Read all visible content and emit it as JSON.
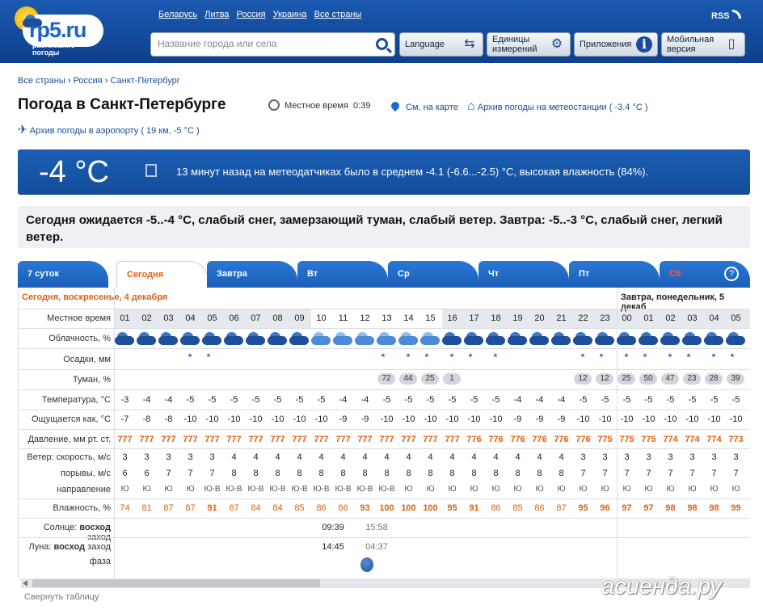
{
  "header": {
    "brand": "rp5.ru",
    "brand_sub_1": "расписание",
    "brand_sub_2": "погоды",
    "links": [
      "Беларусь",
      "Литва",
      "Россия",
      "Украина",
      "Все страны"
    ],
    "rss": "RSS",
    "search_placeholder": "Название города или села",
    "buttons": {
      "language": "Language",
      "units_1": "Единицы",
      "units_2": "измерений",
      "apps": "Приложения",
      "mobile_1": "Мобильная",
      "mobile_2": "версия"
    }
  },
  "breadcrumbs": [
    "Все страны",
    "Россия",
    "Санкт-Петербург"
  ],
  "breadcrumb_sep": "›",
  "title": "Погода в Санкт-Петербурге",
  "local_time_label": "Местное время",
  "local_time": "0:39",
  "map_link": "Сна карте",
  "map_link_text": "См. на карте",
  "station_archive": "Архив погоды на метеостанции",
  "station_temp": "( -3.4 °C )",
  "airport_archive": "Архив погоды в аэропорту",
  "airport_info": "( 19 км, -5 °C )",
  "now": {
    "temp": "-4 °C",
    "text": "13 минут назад на метеодатчиках было в среднем -4.1 (-6.6...-2.5) °C, высокая влажность (84%)."
  },
  "forecast_text": "Сегодня ожидается -5..-4 °C, слабый снег, замерзающий туман, слабый ветер. Завтра: -5..-3 °C, слабый снег, легкий ветер.",
  "tabs": [
    "7 суток",
    "Сегодня",
    "Завтра",
    "Вт",
    "Ср",
    "Чт",
    "Пт",
    "Сб"
  ],
  "help": "?",
  "table": {
    "day1_label": "Сегодня, воскресенье, 4 декабря",
    "day2_label": "Завтра, понедельник, 5 декаб",
    "row_labels": {
      "time": "Местное время",
      "cloud": "Облачность, %",
      "precip": "Осадки, мм",
      "fog": "Туман, %",
      "temp": "Температура, °C",
      "feels": "Ощущается как, °C",
      "pressure": "Давление, мм рт. ст.",
      "wind": "Ветер: скорость, м/с",
      "gust": "порывы, м/с",
      "dir": "направление",
      "humidity": "Влажность, %",
      "sun_prefix": "Солнце:",
      "sun_rise": "восход",
      "sun_set": "заход",
      "moon_prefix": "Луна:",
      "moon_rise": "восход",
      "moon_set": "заход",
      "moon_phase": "фаза"
    },
    "hours": [
      "01",
      "02",
      "03",
      "04",
      "05",
      "06",
      "07",
      "08",
      "09",
      "10",
      "11",
      "12",
      "13",
      "14",
      "15",
      "16",
      "17",
      "18",
      "19",
      "20",
      "21",
      "22",
      "23",
      "00",
      "01",
      "02",
      "03",
      "04",
      "05"
    ],
    "cloud_light": [
      0,
      0,
      0,
      0,
      0,
      0,
      0,
      0,
      0,
      1,
      1,
      1,
      1,
      1,
      1,
      0,
      0,
      0,
      0,
      0,
      0,
      0,
      0,
      0,
      0,
      0,
      0,
      0,
      0
    ],
    "snow": [
      0,
      0,
      0,
      1,
      1,
      0,
      0,
      0,
      0,
      0,
      0,
      0,
      1,
      1,
      1,
      1,
      1,
      1,
      0,
      0,
      0,
      1,
      1,
      1,
      1,
      1,
      1,
      1,
      1
    ],
    "fog": [
      "",
      "",
      "",
      "",
      "",
      "",
      "",
      "",
      "",
      "",
      "",
      "",
      "72",
      "44",
      "25",
      "1",
      "",
      "",
      "",
      "",
      "",
      "12",
      "12",
      "25",
      "50",
      "47",
      "23",
      "28",
      "39"
    ],
    "temp": [
      "-3",
      "-4",
      "-4",
      "-5",
      "-5",
      "-5",
      "-5",
      "-5",
      "-5",
      "-5",
      "-4",
      "-4",
      "-5",
      "-5",
      "-5",
      "-5",
      "-5",
      "-5",
      "-4",
      "-4",
      "-4",
      "-5",
      "-5",
      "-5",
      "-5",
      "-5",
      "-5",
      "-5",
      "-5"
    ],
    "feels": [
      "-7",
      "-8",
      "-8",
      "-10",
      "-10",
      "-10",
      "-10",
      "-10",
      "-10",
      "-10",
      "-9",
      "-9",
      "-10",
      "-10",
      "-10",
      "-10",
      "-10",
      "-10",
      "-9",
      "-9",
      "-9",
      "-10",
      "-10",
      "-10",
      "-10",
      "-10",
      "-10",
      "-10",
      "-10"
    ],
    "pressure": [
      "777",
      "777",
      "777",
      "777",
      "777",
      "777",
      "777",
      "777",
      "777",
      "777",
      "777",
      "777",
      "777",
      "777",
      "777",
      "777",
      "776",
      "776",
      "776",
      "776",
      "776",
      "776",
      "775",
      "775",
      "775",
      "774",
      "774",
      "774",
      "773"
    ],
    "wind": [
      "3",
      "3",
      "3",
      "3",
      "3",
      "4",
      "4",
      "4",
      "4",
      "4",
      "4",
      "4",
      "4",
      "4",
      "4",
      "4",
      "4",
      "4",
      "4",
      "4",
      "4",
      "3",
      "3",
      "3",
      "3",
      "3",
      "3",
      "3",
      "3"
    ],
    "gust": [
      "6",
      "6",
      "7",
      "7",
      "7",
      "8",
      "8",
      "8",
      "8",
      "8",
      "8",
      "8",
      "8",
      "8",
      "8",
      "8",
      "8",
      "8",
      "8",
      "8",
      "8",
      "7",
      "7",
      "7",
      "7",
      "7",
      "7",
      "7",
      "7"
    ],
    "dir": [
      "Ю",
      "Ю",
      "Ю",
      "Ю",
      "Ю-В",
      "Ю-В",
      "Ю-В",
      "Ю-В",
      "Ю-В",
      "Ю-В",
      "Ю-В",
      "Ю-В",
      "Ю-В",
      "Ю",
      "Ю",
      "Ю",
      "Ю",
      "Ю",
      "Ю",
      "Ю",
      "Ю",
      "Ю",
      "Ю",
      "Ю",
      "Ю",
      "Ю",
      "Ю",
      "Ю",
      "Ю"
    ],
    "humidity": [
      "74",
      "81",
      "87",
      "87",
      "91",
      "87",
      "84",
      "84",
      "85",
      "86",
      "86",
      "93",
      "100",
      "100",
      "100",
      "95",
      "91",
      "86",
      "85",
      "86",
      "87",
      "95",
      "96",
      "97",
      "97",
      "98",
      "98",
      "98",
      "99"
    ],
    "sunrise": "09:39",
    "sunset": "15:58",
    "moonrise": "14:45",
    "moonset": "04:37"
  },
  "collapse": "Свернуть таблицу",
  "watermark": "асиенда.ру",
  "colors": {
    "accent": "#1a5eb8",
    "orange": "#e06010",
    "snow": "#2a6ec4"
  }
}
